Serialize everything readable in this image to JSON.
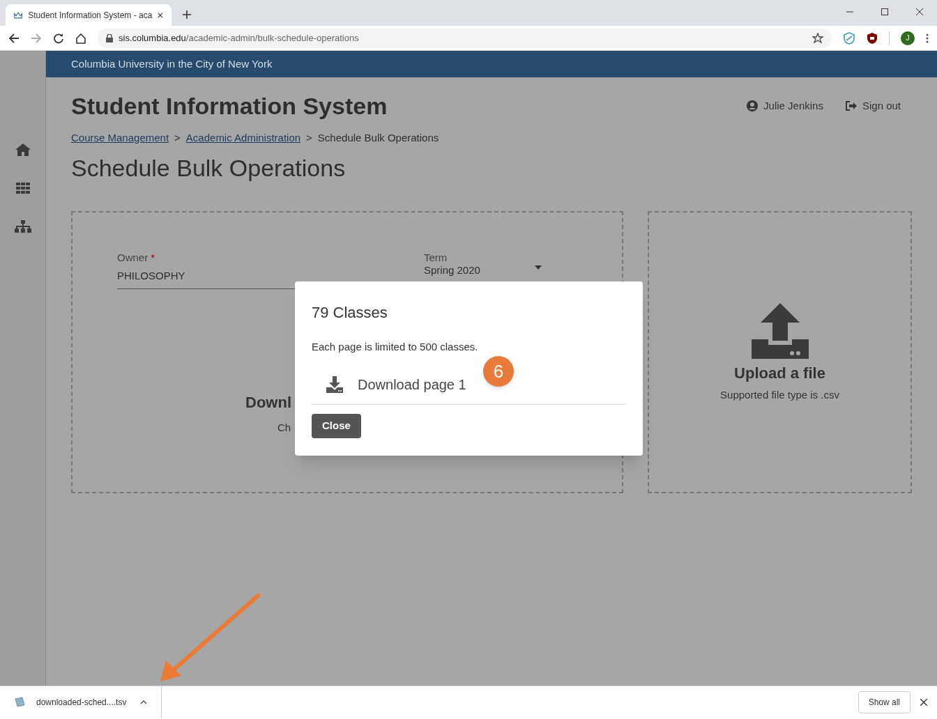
{
  "browser": {
    "tab_title": "Student Information System - aca",
    "url_host": "sis.columbia.edu",
    "url_path": "/academic-admin/bulk-schedule-operations",
    "avatar": "J"
  },
  "banner": "Columbia University in the City of New York",
  "header": {
    "title": "Student Information System",
    "user": "Julie Jenkins",
    "sign_out": "Sign out"
  },
  "breadcrumbs": [
    {
      "label": "Course Management",
      "link": true
    },
    {
      "label": "Academic Administration",
      "link": true
    },
    {
      "label": "Schedule Bulk Operations",
      "link": false
    }
  ],
  "breadcrumb_separator": ">",
  "page_title": "Schedule Bulk Operations",
  "download_panel": {
    "owner_label": "Owner",
    "required_mark": "*",
    "owner_value": "PHILOSOPHY",
    "term_label": "Term",
    "term_value": "Spring 2020",
    "heading": "Downl",
    "subtext": "Ch"
  },
  "upload_panel": {
    "heading": "Upload a file",
    "subtext": "Supported file type is .csv"
  },
  "dialog": {
    "title": "79 Classes",
    "message": "Each page is limited to 500 classes.",
    "items": [
      "Download page 1"
    ],
    "close": "Close"
  },
  "callout": {
    "number": "6"
  },
  "download_bar": {
    "file": "downloaded-sched....tsv",
    "show_all": "Show all"
  }
}
